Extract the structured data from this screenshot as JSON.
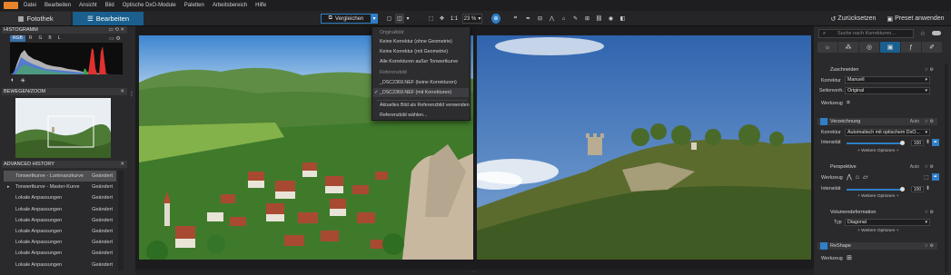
{
  "menu": [
    "Datei",
    "Bearbeiten",
    "Ansicht",
    "Bild",
    "Optische DxO-Module",
    "Paletten",
    "Arbeitsbereich",
    "Hilfe"
  ],
  "tabs": {
    "photo_library": "Fotothek",
    "edit": "Bearbeiten"
  },
  "toolbar": {
    "compare_label": "Vergleichen",
    "zoom_ratio": "1:1",
    "zoom_percent": "23 %",
    "reset_label": "Zurücksetzen",
    "preset_label": "Preset anwenden"
  },
  "compare_menu": {
    "group_original": "Originalbild",
    "items_original": [
      "Keine Korrektur (ohne Geometrie)",
      "Keine Korrektur (mit Geometrie)",
      "Alle Korrekturen außer Tonwertkurve"
    ],
    "group_reference": "Referenzbild",
    "items_reference": [
      "_DSC2369.NEF (keine Korrekturen)",
      "_DSC2369.NEF (mit Korrekturen)"
    ],
    "selected_check": "✓",
    "action_use_current": "Aktuelles Bild als Referenzbild verwenden",
    "action_choose": "Referenzbild wählen..."
  },
  "histogram": {
    "title": "HISTOGRAMM",
    "channels": [
      "RGB",
      "R",
      "G",
      "B",
      "L"
    ],
    "selected_channel": "RGB"
  },
  "navigator": {
    "title": "BEWEGEN/ZOOM"
  },
  "history": {
    "title": "ADVANCED HISTORY",
    "rows": [
      {
        "label": "Tonwertkurve - Luminanzkurve",
        "status": "Geändert"
      },
      {
        "label": "Tonwertkurve - Master-Kurve",
        "status": "Geändert"
      },
      {
        "label": "Lokale Anpassungen",
        "status": "Geändert"
      },
      {
        "label": "Lokale Anpassungen",
        "status": "Geändert"
      },
      {
        "label": "Lokale Anpassungen",
        "status": "Geändert"
      },
      {
        "label": "Lokale Anpassungen",
        "status": "Geändert"
      },
      {
        "label": "Lokale Anpassungen",
        "status": "Geändert"
      },
      {
        "label": "Lokale Anpassungen",
        "status": "Geändert"
      },
      {
        "label": "Lokale Anpassungen",
        "status": "Geändert"
      }
    ]
  },
  "right_panel": {
    "search_placeholder": "Suche nach Korrekturen...",
    "crop": {
      "title": "Zuschneiden",
      "corr_label": "Korrektur",
      "corr_value": "Manuell",
      "ratio_label": "Seitenverh.",
      "ratio_value": "Original",
      "tool_label": "Werkzeug"
    },
    "distortion": {
      "title": "Verzeichnung",
      "auto": "Auto",
      "corr_label": "Korrektur",
      "corr_value": "Automatisch mit optischem DxO...",
      "intensity_label": "Intensität",
      "intensity_value": "100",
      "intensity": 1.0,
      "more": "+ Weitere Optionen +"
    },
    "perspective": {
      "title": "Perspektive",
      "auto": "Auto",
      "tool_label": "Werkzeug",
      "intensity_label": "Intensität",
      "intensity_value": "100",
      "intensity": 1.0,
      "more": "+ Weitere Optionen +"
    },
    "volume": {
      "title": "Volumendeformation",
      "type_label": "Typ",
      "type_value": "Diagonal",
      "more": "+ Weitere Optionen +"
    },
    "reshape": {
      "title": "ReShape",
      "tool_label": "Werkzeug"
    }
  },
  "colors": {
    "accent": "#1a5f8d",
    "slider": "#2e7fc7"
  }
}
